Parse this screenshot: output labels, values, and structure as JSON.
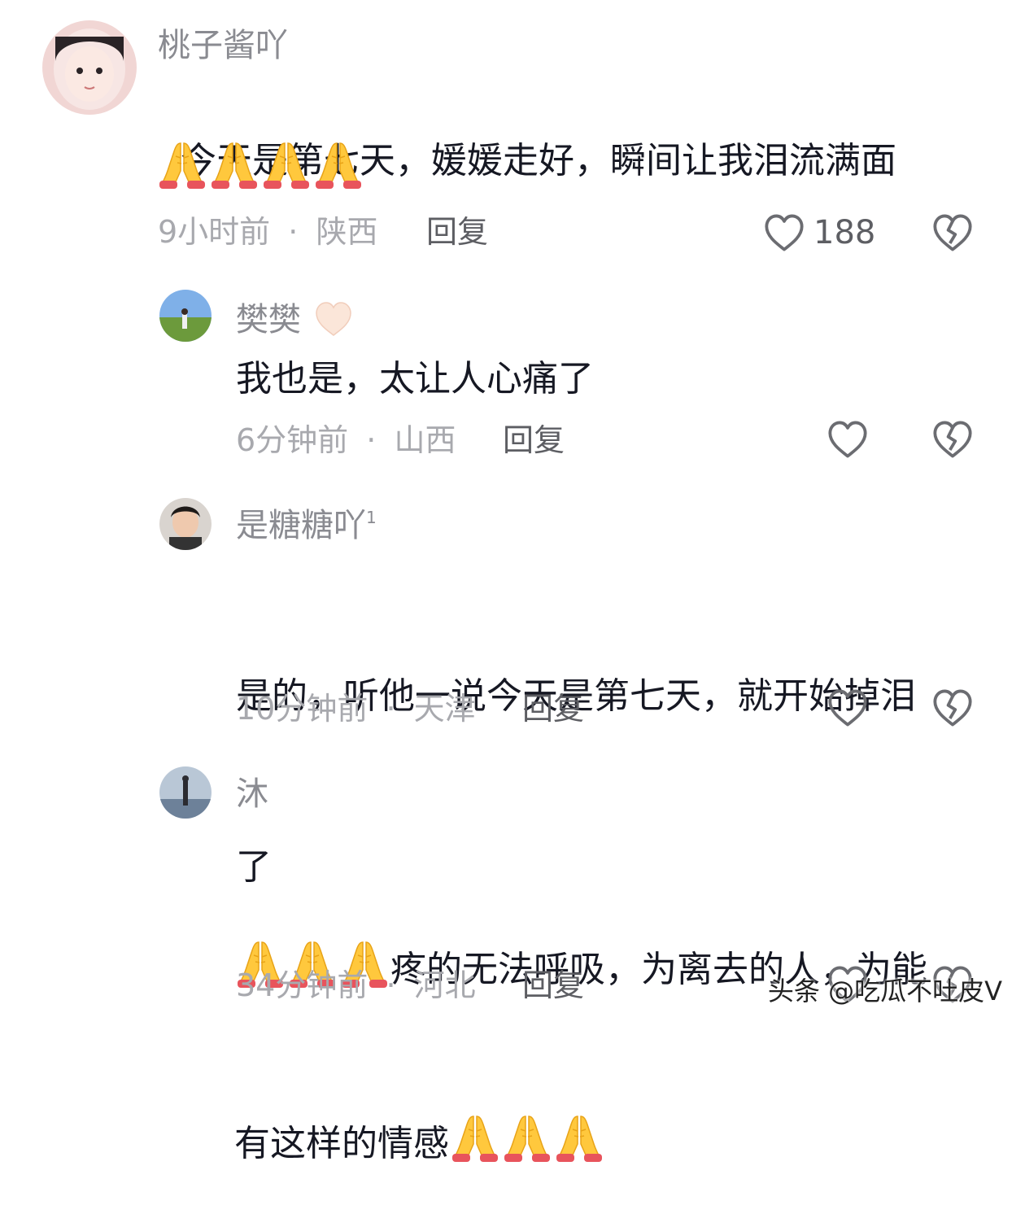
{
  "comments": [
    {
      "username": "桃子酱吖",
      "text": "今天是第七天，媛媛走好，瞬间让我泪流满面",
      "text_line2": "",
      "emoji_count_inline": 4,
      "time": "9小时前",
      "location": "陕西",
      "reply_label": "回复",
      "like_count": "188"
    },
    {
      "username": "樊樊",
      "text": "我也是，太让人心痛了",
      "time": "6分钟前",
      "location": "山西",
      "reply_label": "回复",
      "like_count": ""
    },
    {
      "username": "是糖糖吖",
      "username_sup": "1",
      "text": "是的，听他一说今天是第七天，就开始掉泪",
      "text_line2": "了",
      "time": "10分钟前",
      "location": "天津",
      "reply_label": "回复",
      "like_count": ""
    },
    {
      "username": "沐",
      "text_part1": "疼的无法呼吸，为离去的人，为能",
      "text_part2": "有这样的情感",
      "time": "34分钟前",
      "location": "河北",
      "reply_label": "回复",
      "like_count": ""
    }
  ],
  "separator": "·",
  "watermark": "头条 @吃瓜不吐皮V",
  "icons": {
    "like": "heart-outline-icon",
    "dislike": "broken-heart-icon",
    "emoji": "folded-hands-emoji",
    "name_emoji": "white-heart-emoji"
  },
  "colors": {
    "text": "#161823",
    "muted": "#a8a9ae",
    "name": "#8a8b91"
  }
}
